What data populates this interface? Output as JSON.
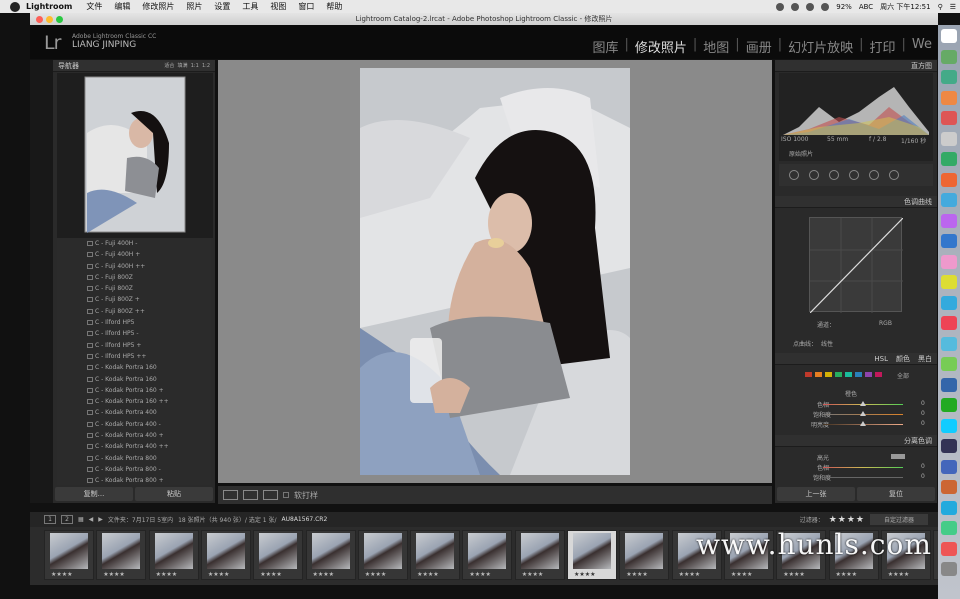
{
  "menubar": {
    "app_name": "Lightroom",
    "items": [
      "文件",
      "编辑",
      "修改照片",
      "照片",
      "设置",
      "工具",
      "视图",
      "窗口",
      "帮助"
    ],
    "battery": "92%",
    "input_method": "ABC",
    "datetime": "周六 下午12:51"
  },
  "window": {
    "title": "Lightroom Catalog-2.lrcat - Adobe Photoshop Lightroom Classic - 修改照片"
  },
  "identity": {
    "logo": "Lr",
    "product": "Adobe Lightroom Classic CC",
    "user": "LIANG JINPING"
  },
  "modules": [
    "图库",
    "修改照片",
    "地图",
    "画册",
    "幻灯片放映",
    "打印",
    "We"
  ],
  "active_module": "修改照片",
  "navigator": {
    "title": "导航器",
    "zoom": [
      "适合",
      "填满",
      "1:1",
      "1:2"
    ]
  },
  "presets": [
    "C - Fuji 400H -",
    "C - Fuji 400H +",
    "C - Fuji 400H ++",
    "C - Fuji 800Z",
    "C - Fuji 800Z",
    "C - Fuji 800Z +",
    "C - Fuji 800Z ++",
    "C - Ilford HP5",
    "C - Ilford HP5 -",
    "C - Ilford HP5 +",
    "C - Ilford HP5 ++",
    "C - Kodak Portra 160",
    "C - Kodak Portra 160",
    "C - Kodak Portra 160 +",
    "C - Kodak Portra 160 ++",
    "C - Kodak Portra 400",
    "C - Kodak Portra 400 -",
    "C - Kodak Portra 400 +",
    "C - Kodak Portra 400 ++",
    "C - Kodak Portra 800",
    "C - Kodak Portra 800 -",
    "C - Kodak Portra 800 +"
  ],
  "left_buttons": {
    "copy": "复制...",
    "paste": "粘贴"
  },
  "toolbar": {
    "softproof": "软打样"
  },
  "histogram": {
    "title": "直方图",
    "iso": "ISO 1000",
    "focal": "55 mm",
    "aperture": "f / 2.8",
    "shutter": "1/160 秒",
    "original": "原始照片"
  },
  "tone_curve": {
    "title": "色调曲线",
    "channel_label": "通道：",
    "channel": "RGB",
    "point_curve_label": "点曲线：",
    "point_curve": "线性"
  },
  "hsl": {
    "tabs": [
      "HSL",
      "颜色",
      "黑白"
    ],
    "all": "全部",
    "section": "橙色",
    "rows": [
      {
        "label": "色相",
        "value": "0"
      },
      {
        "label": "饱和度",
        "value": "0"
      },
      {
        "label": "明亮度",
        "value": "0"
      }
    ],
    "swatch_colors": [
      "#c0392b",
      "#e67e22",
      "#d4b106",
      "#27ae60",
      "#1abc9c",
      "#2980b9",
      "#8e44ad",
      "#c2185b"
    ]
  },
  "split_toning": {
    "title": "分离色调",
    "highlight": "高光",
    "rows": [
      {
        "label": "色相",
        "value": "0"
      },
      {
        "label": "饱和度",
        "value": "0"
      }
    ]
  },
  "right_buttons": {
    "prev": "上一张",
    "reset": "复位"
  },
  "filmbar": {
    "pages": [
      "1",
      "2"
    ],
    "path_info": "文件夹：7月17日 5室内",
    "count_info": "18 张照片（共 940 张）/ 选定 1 张/",
    "filename": "AU8A1567.CR2",
    "filter_label": "过滤器：",
    "rating": "★★★★",
    "custom_filter": "自定过滤器"
  },
  "filmstrip": {
    "thumbnail_count": 18,
    "selected_index": 10,
    "thumb_rating": "★★★★"
  },
  "watermark": "www.hunls.com"
}
